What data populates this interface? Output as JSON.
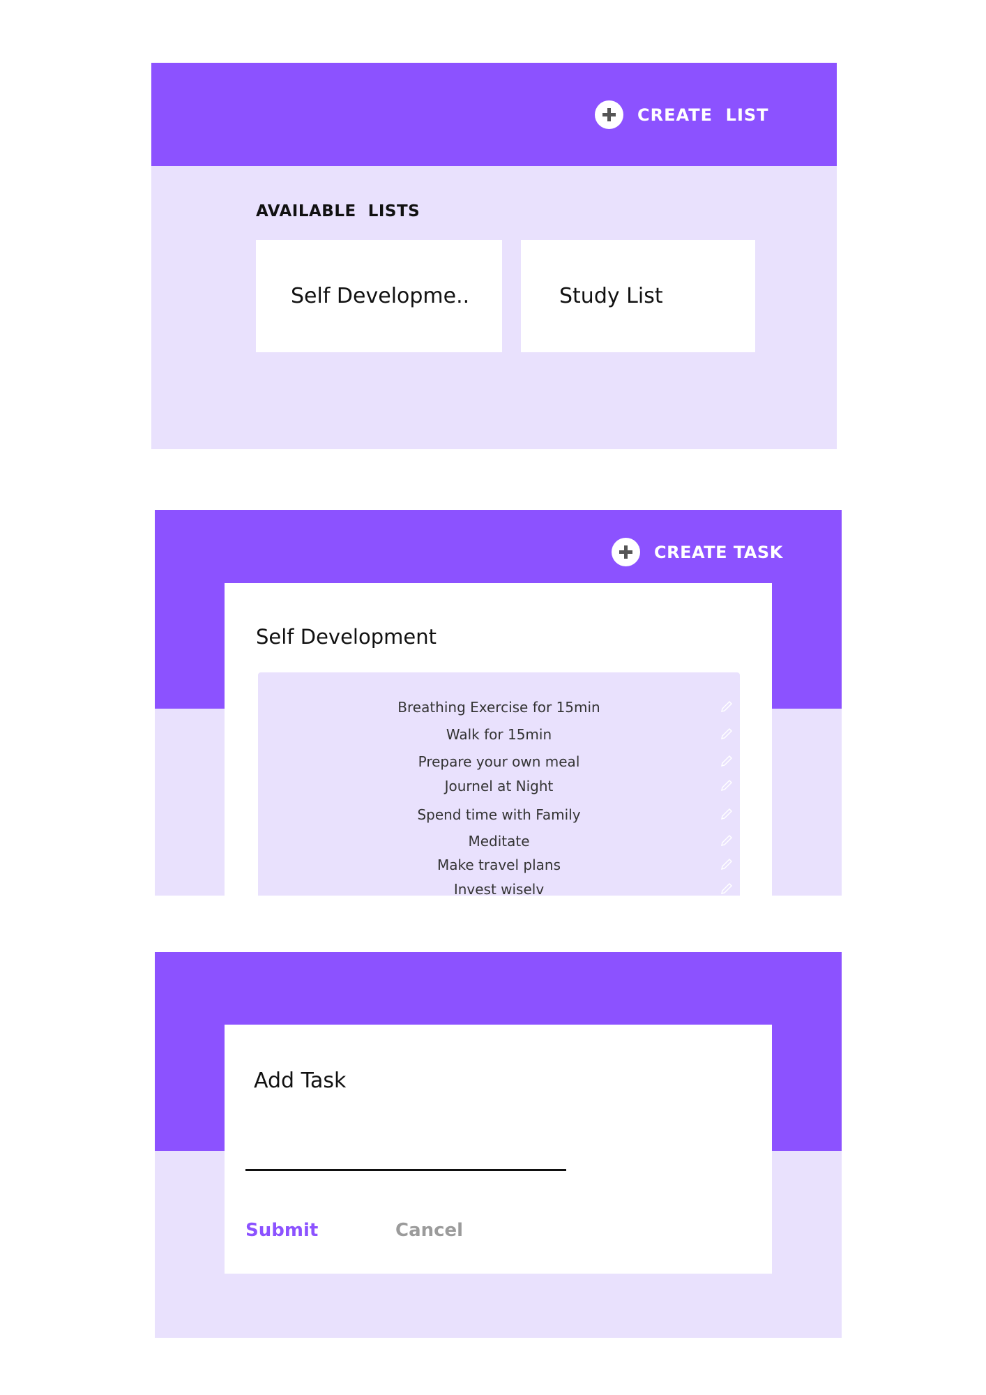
{
  "screen1": {
    "create_list_label": "CREATE  LIST",
    "section_title": "AVAILABLE  LISTS",
    "lists": [
      {
        "label": "Self Developme.."
      },
      {
        "label": "Study List"
      }
    ]
  },
  "screen2": {
    "create_task_label": "CREATE TASK",
    "list_title": "Self Development",
    "tasks": [
      {
        "label": "Breathing Exercise for 15min"
      },
      {
        "label": "Walk for 15min"
      },
      {
        "label": "Prepare your own meal"
      },
      {
        "label": "Journel at Night"
      },
      {
        "label": "Spend time with Family"
      },
      {
        "label": "Meditate"
      },
      {
        "label": "Make travel plans"
      },
      {
        "label": "Invest wiselv"
      }
    ]
  },
  "screen3": {
    "form_title": "Add Task",
    "input_value": "",
    "submit_label": "Submit",
    "cancel_label": "Cancel"
  },
  "colors": {
    "accent": "#8c52ff",
    "panel_bg": "#e9e1fd",
    "card_bg": "#ffffff",
    "muted_text": "#9b9b9b"
  },
  "icons": {
    "create": "plus-circle-icon",
    "edit": "pencil-icon"
  }
}
